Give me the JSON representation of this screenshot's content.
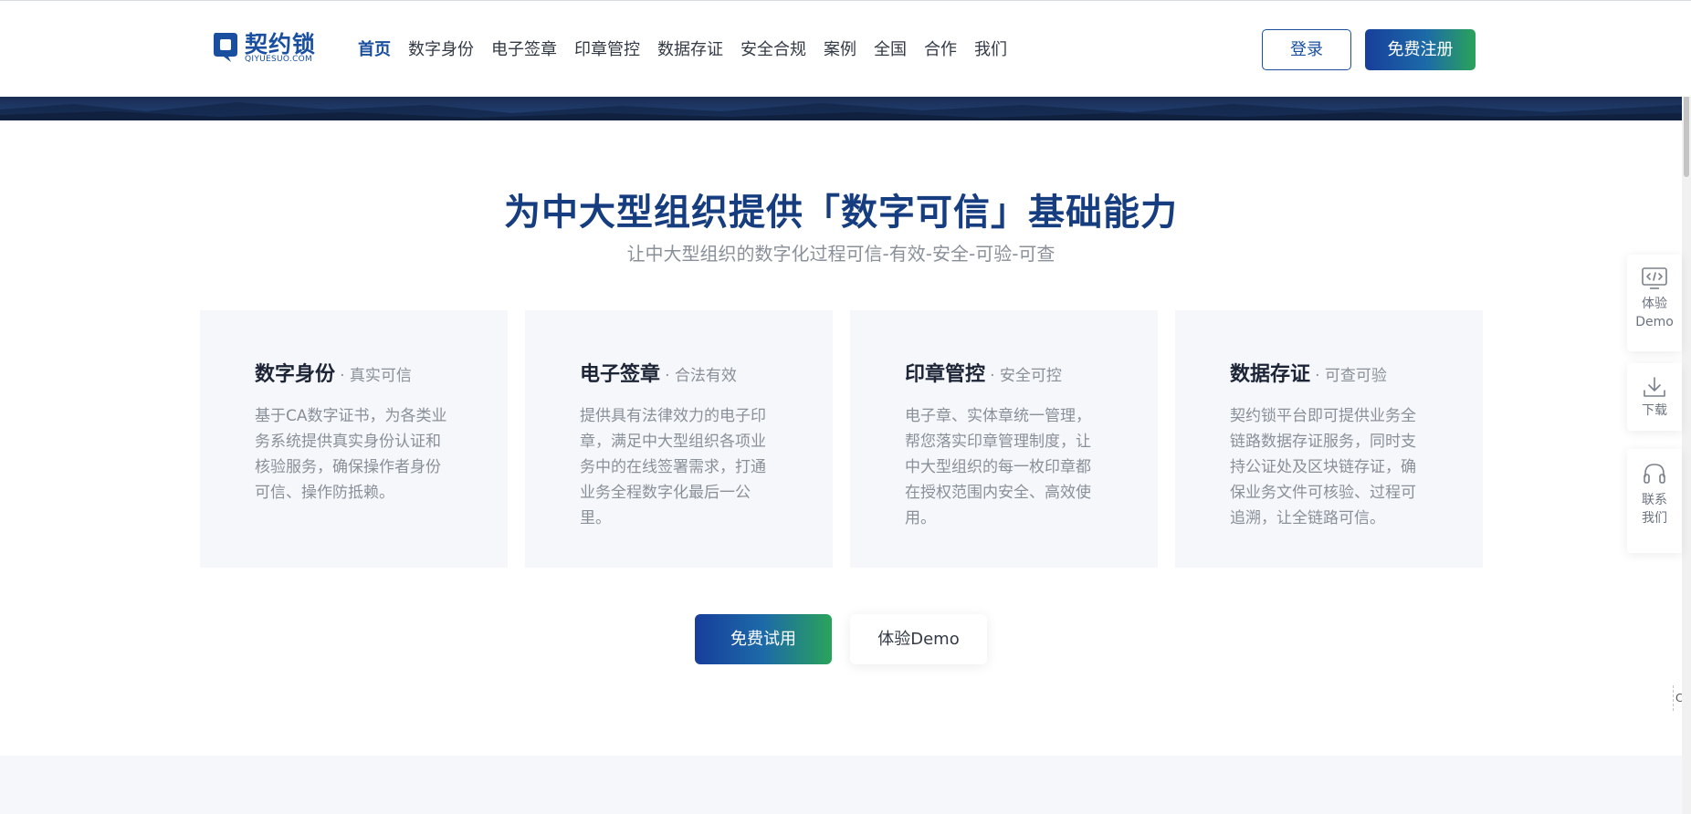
{
  "header": {
    "logo_cn": "契约锁",
    "logo_en": "QIYUESUO.COM",
    "nav": [
      {
        "label": "首页",
        "active": true
      },
      {
        "label": "数字身份",
        "active": false
      },
      {
        "label": "电子签章",
        "active": false
      },
      {
        "label": "印章管控",
        "active": false
      },
      {
        "label": "数据存证",
        "active": false
      },
      {
        "label": "安全合规",
        "active": false
      },
      {
        "label": "案例",
        "active": false
      },
      {
        "label": "全国",
        "active": false
      },
      {
        "label": "合作",
        "active": false
      },
      {
        "label": "我们",
        "active": false
      }
    ],
    "login_label": "登录",
    "register_label": "免费注册"
  },
  "section": {
    "title": "为中大型组织提供「数字可信」基础能力",
    "subtitle": "让中大型组织的数字化过程可信-有效-安全-可验-可查"
  },
  "cards": [
    {
      "title": "数字身份",
      "tag": "· 真实可信",
      "desc": "基于CA数字证书，为各类业务系统提供真实身份认证和核验服务，确保操作者身份可信、操作防抵赖。"
    },
    {
      "title": "电子签章",
      "tag": "· 合法有效",
      "desc": "提供具有法律效力的电子印章，满足中大型组织各项业务中的在线签署需求，打通业务全程数字化最后一公里。"
    },
    {
      "title": "印章管控",
      "tag": "· 安全可控",
      "desc": "电子章、实体章统一管理，帮您落实印章管理制度，让中大型组织的每一枚印章都在授权范围内安全、高效使用。"
    },
    {
      "title": "数据存证",
      "tag": "· 可查可验",
      "desc": "契约锁平台即可提供业务全链路数据存证服务，同时支持公证处及区块链存证，确保业务文件可核验、过程可追溯，让全链路可信。"
    }
  ],
  "actions": {
    "trial_label": "免费试用",
    "demo_label": "体验Demo"
  },
  "side_panel": {
    "demo_label": "体验",
    "demo_label2": "Demo",
    "download_label": "下载",
    "contact_label": "联系",
    "contact_label2": "我们"
  },
  "edge_tag": "C",
  "colors": {
    "brand_blue": "#1a4fa0",
    "title_blue": "#163d7f",
    "gradient_green": "#2aa35a"
  }
}
